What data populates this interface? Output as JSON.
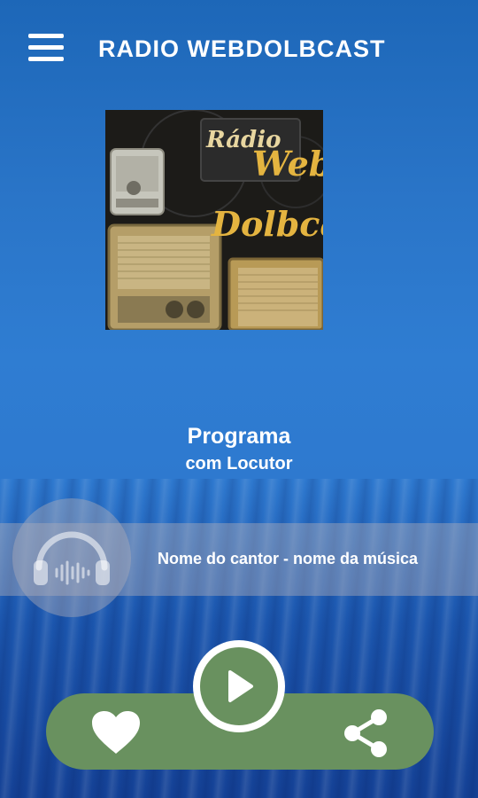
{
  "header": {
    "title": "RADIO WEBDOLBCAST"
  },
  "cover": {
    "line1": "Rádio",
    "line2": "Web",
    "line3": "Dolbca"
  },
  "program": {
    "title": "Programa",
    "host": "com Locutor"
  },
  "now_playing": {
    "text": "Nome do cantor - nome da música"
  },
  "colors": {
    "accent_green": "#69915f",
    "text": "#ffffff"
  },
  "icons": {
    "menu": "hamburger-menu-icon",
    "headphones": "headphones-icon",
    "play": "play-icon",
    "like": "heart-icon",
    "share": "share-icon"
  }
}
